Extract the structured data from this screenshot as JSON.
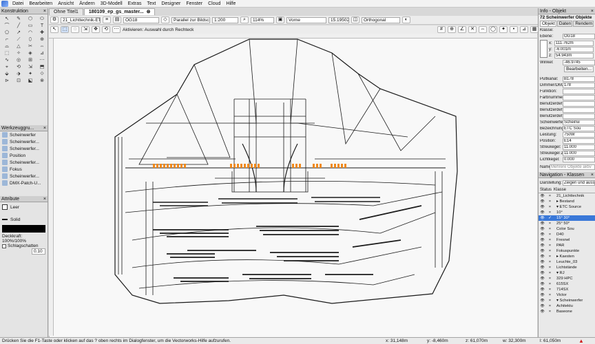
{
  "menu": [
    "Datei",
    "Bearbeiten",
    "Ansicht",
    "Ändern",
    "3D-Modell",
    "Extras",
    "Text",
    "Designer",
    "Fenster",
    "Cloud",
    "Hilfe"
  ],
  "tabs": [
    {
      "label": "Ohne Titel1",
      "active": false
    },
    {
      "label": "180109_ep_gs_master...",
      "active": true
    }
  ],
  "view_bar": {
    "layer": "21_Lichttechnik-ET...",
    "class": "OG18",
    "plane": "Parallel zur Bildschir...",
    "scale": "1:200",
    "zoom": "114%",
    "view": "Vorne",
    "value": "15.195025",
    "projection": "Orthogonal"
  },
  "mode_bar": {
    "hint": "Aktivieren: Auswahl durch Rechteck"
  },
  "left_panel": {
    "title": "Konstruktion",
    "tools": [
      "↖",
      "✎",
      "⬡",
      "⬭",
      "⌒",
      "╱",
      "▭",
      "T",
      "⬠",
      "↗",
      "◠",
      "✚",
      "⌐",
      "⟋",
      "⬯",
      "⊕",
      "⌓",
      "△",
      "✂",
      "⇔",
      "⬚",
      "✧",
      "◈",
      "⊿",
      "∿",
      "◎",
      "⊞",
      "⋯",
      "⌖",
      "⟲",
      "⇲",
      "⬒",
      "⬙",
      "⬗",
      "✦",
      "⟐",
      "⊳",
      "⊡",
      "⬕",
      "⊗"
    ],
    "workspace_title": "Werkzeuggru...",
    "workspace_items": [
      "Scheinwerfer",
      "Scheinwerfer...",
      "Scheinwerfer...",
      "Position",
      "Scheinwerfer...",
      "Fokus",
      "Scheinwerfer...",
      "DMX-Patch-U..."
    ],
    "attr_title": "Attribute",
    "attr_fill": "Leer",
    "attr_line": "Solid",
    "opacity": "Deckkraft: 100%/100%",
    "shadow": "Schlagschatten",
    "line_weight": "0.10"
  },
  "right_panel": {
    "title": "Info - Objekt",
    "object_count": "72 Scheinwerfer Objekte",
    "tabs": [
      "Objekt",
      "Daten",
      "Rendern"
    ],
    "class_label": "Klasse:",
    "layer_label": "Ebene:",
    "layer_value": "OG18",
    "x": "111.762m",
    "y": "-6.001m",
    "z": "54.943m",
    "angle_label": "Winkel:",
    "angle_value": "-46.9745",
    "edit_button": "Bearbeiten...",
    "props": [
      {
        "k": "Pultkanal:",
        "v": "B178"
      },
      {
        "k": "Dimmer/DMX:",
        "v": "178"
      },
      {
        "k": "Funktion:",
        "v": ""
      },
      {
        "k": "Farbnummer:",
        "v": ""
      },
      {
        "k": "Benutzerdef. 1:",
        "v": ""
      },
      {
        "k": "Benutzerdef. 2:",
        "v": ""
      },
      {
        "k": "Benutzerdef. 3:",
        "v": ""
      },
      {
        "k": "Scheinwerfer/Zubehör:",
        "v": "Scheinw"
      },
      {
        "k": "Bezeichnung:",
        "v": "ETC Sou"
      },
      {
        "k": "Leistung:",
        "v": "750W"
      },
      {
        "k": "Position:",
        "v": "E14"
      },
      {
        "k": "Streukegel:",
        "v": "11.000"
      },
      {
        "k": "Streukegel 2:",
        "v": "11.000"
      },
      {
        "k": "Lichtkegel:",
        "v": "0.000"
      }
    ],
    "name_label": "Name:",
    "name_value": "Mehrere Objekte aktiv",
    "nav_title": "Navigation - Klassen",
    "display_label": "Darstellung:",
    "display_value": "Zeigen und ausschlie",
    "col_status": "Status",
    "col_class": "Klasse",
    "classes": [
      {
        "label": "21_Lichttechnik",
        "sel": false,
        "mark": "×"
      },
      {
        "label": "▸ Bestand",
        "sel": false,
        "mark": "×"
      },
      {
        "label": "▾ ETC Source",
        "sel": false,
        "mark": "×"
      },
      {
        "label": "10°",
        "sel": false,
        "mark": "×"
      },
      {
        "label": "15° 30°",
        "sel": true,
        "mark": "✓"
      },
      {
        "label": "25° 50°",
        "sel": false,
        "mark": "×"
      },
      {
        "label": "Color Sou",
        "sel": false,
        "mark": "×"
      },
      {
        "label": "D40",
        "sel": false,
        "mark": "×"
      },
      {
        "label": "Fresnel",
        "sel": false,
        "mark": "×"
      },
      {
        "label": "PAR",
        "sel": false,
        "mark": "×"
      },
      {
        "label": "Fokuspunkte",
        "sel": false,
        "mark": "×"
      },
      {
        "label": "▸ Kaesten",
        "sel": false,
        "mark": "×"
      },
      {
        "label": "Leuchte_03",
        "sel": false,
        "mark": "×"
      },
      {
        "label": "Lichtstände",
        "sel": false,
        "mark": "×"
      },
      {
        "label": "▾ RJ",
        "sel": false,
        "mark": "×"
      },
      {
        "label": "329 HPC",
        "sel": false,
        "mark": "×"
      },
      {
        "label": "615SX",
        "sel": false,
        "mark": "×"
      },
      {
        "label": "714SX",
        "sel": false,
        "mark": "×"
      },
      {
        "label": "Victor",
        "sel": false,
        "mark": "×"
      },
      {
        "label": "▾ Scheinwerfer",
        "sel": false,
        "mark": "×"
      },
      {
        "label": "Achitektu",
        "sel": false,
        "mark": "×"
      },
      {
        "label": "Baseone",
        "sel": false,
        "mark": "×"
      }
    ]
  },
  "status": {
    "help": "Drücken Sie die F1-Taste oder klicken auf das ? oben rechts im Dialogfenster, um die Vectorworks-Hilfe aufzurufen.",
    "x": "x: 31,148m",
    "y": "y: -8,460m",
    "z": "z: 61,070m",
    "w": "w: 32,300m",
    "l": "l: 61,050m"
  },
  "colors": {
    "accent": "#3a78d8",
    "lights": "#f08a1c"
  }
}
